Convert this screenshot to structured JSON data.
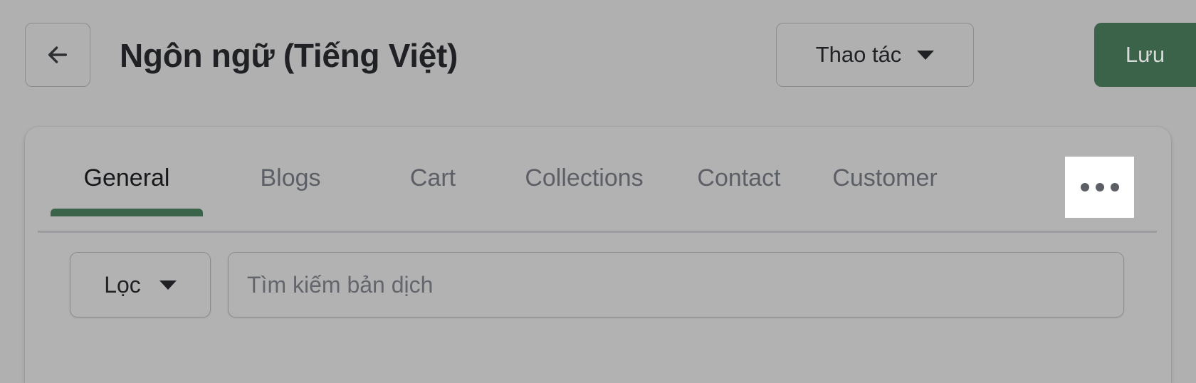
{
  "header": {
    "back_button_icon": "arrow-left-icon",
    "title": "Ngôn ngữ (Tiếng Việt)",
    "action_menu_label": "Thao tác",
    "action_menu_caret_icon": "chevron-down-icon",
    "save_label": "Lưu"
  },
  "card": {
    "tabs": [
      {
        "label": "General",
        "active": true
      },
      {
        "label": "Blogs",
        "active": false
      },
      {
        "label": "Cart",
        "active": false
      },
      {
        "label": "Collections",
        "active": false
      },
      {
        "label": "Contact",
        "active": false
      },
      {
        "label": "Customer",
        "active": false
      }
    ],
    "tab_overflow_icon": "ellipsis-horizontal-icon",
    "filter": {
      "label": "Lọc",
      "caret_icon": "chevron-down-icon"
    },
    "search": {
      "placeholder": "Tìm kiếm bản dịch",
      "value": ""
    }
  },
  "colors": {
    "accent_green": "#3b6349",
    "page_background": "#b0b0b0",
    "card_background": "#b2b2b2",
    "overflow_button_background": "#ffffff",
    "text_primary": "#1f2124",
    "text_muted": "#5c5f65",
    "border": "#8b8d90"
  }
}
